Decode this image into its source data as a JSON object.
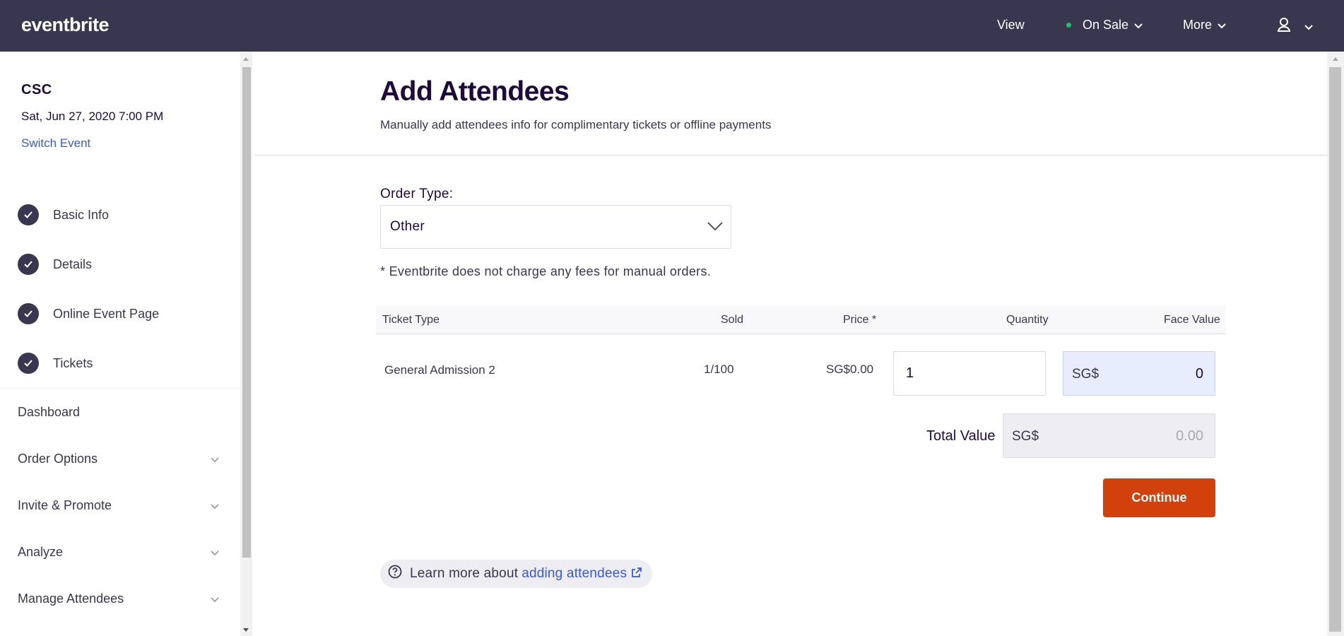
{
  "topbar": {
    "logo": "eventbrite",
    "view_label": "View",
    "status_label": "On Sale",
    "more_label": "More",
    "status_color": "#1cc36e",
    "bg_color": "#39364f"
  },
  "sidebar": {
    "event_name": "CSC",
    "event_date": "Sat, Jun 27, 2020 7:00 PM",
    "switch_event": "Switch Event",
    "steps": [
      {
        "label": "Basic Info",
        "icon": "check-icon"
      },
      {
        "label": "Details",
        "icon": "check-icon"
      },
      {
        "label": "Online Event Page",
        "icon": "check-icon"
      },
      {
        "label": "Tickets",
        "icon": "check-icon"
      }
    ],
    "items": [
      {
        "label": "Dashboard"
      },
      {
        "label": "Order Options",
        "icon": "chevron-down-icon"
      },
      {
        "label": "Invite & Promote",
        "icon": "chevron-down-icon"
      },
      {
        "label": "Analyze",
        "icon": "chevron-down-icon"
      },
      {
        "label": "Manage Attendees",
        "icon": "chevron-down-icon"
      }
    ]
  },
  "main": {
    "title": "Add Attendees",
    "subtitle": "Manually add attendees info for complimentary tickets or offline payments",
    "order_type_label": "Order Type:",
    "order_type_value": "Other",
    "fee_note": "* Eventbrite does not charge any fees for manual orders.",
    "table": {
      "headers": [
        "Ticket Type",
        "Sold",
        "Price *",
        "Quantity",
        "Face Value"
      ],
      "rows": [
        {
          "ticket_type": "General Admission 2",
          "sold": "1/100",
          "price": "SG$0.00",
          "quantity": "1",
          "face_currency": "SG$",
          "face_value": "0"
        }
      ]
    },
    "total_label": "Total Value",
    "total_currency": "SG$",
    "total_value": "0.00",
    "continue_label": "Continue",
    "continue_color": "#d1410c",
    "learn_text": "Learn more about",
    "learn_link": "adding attendees",
    "link_color": "#3659e3"
  }
}
